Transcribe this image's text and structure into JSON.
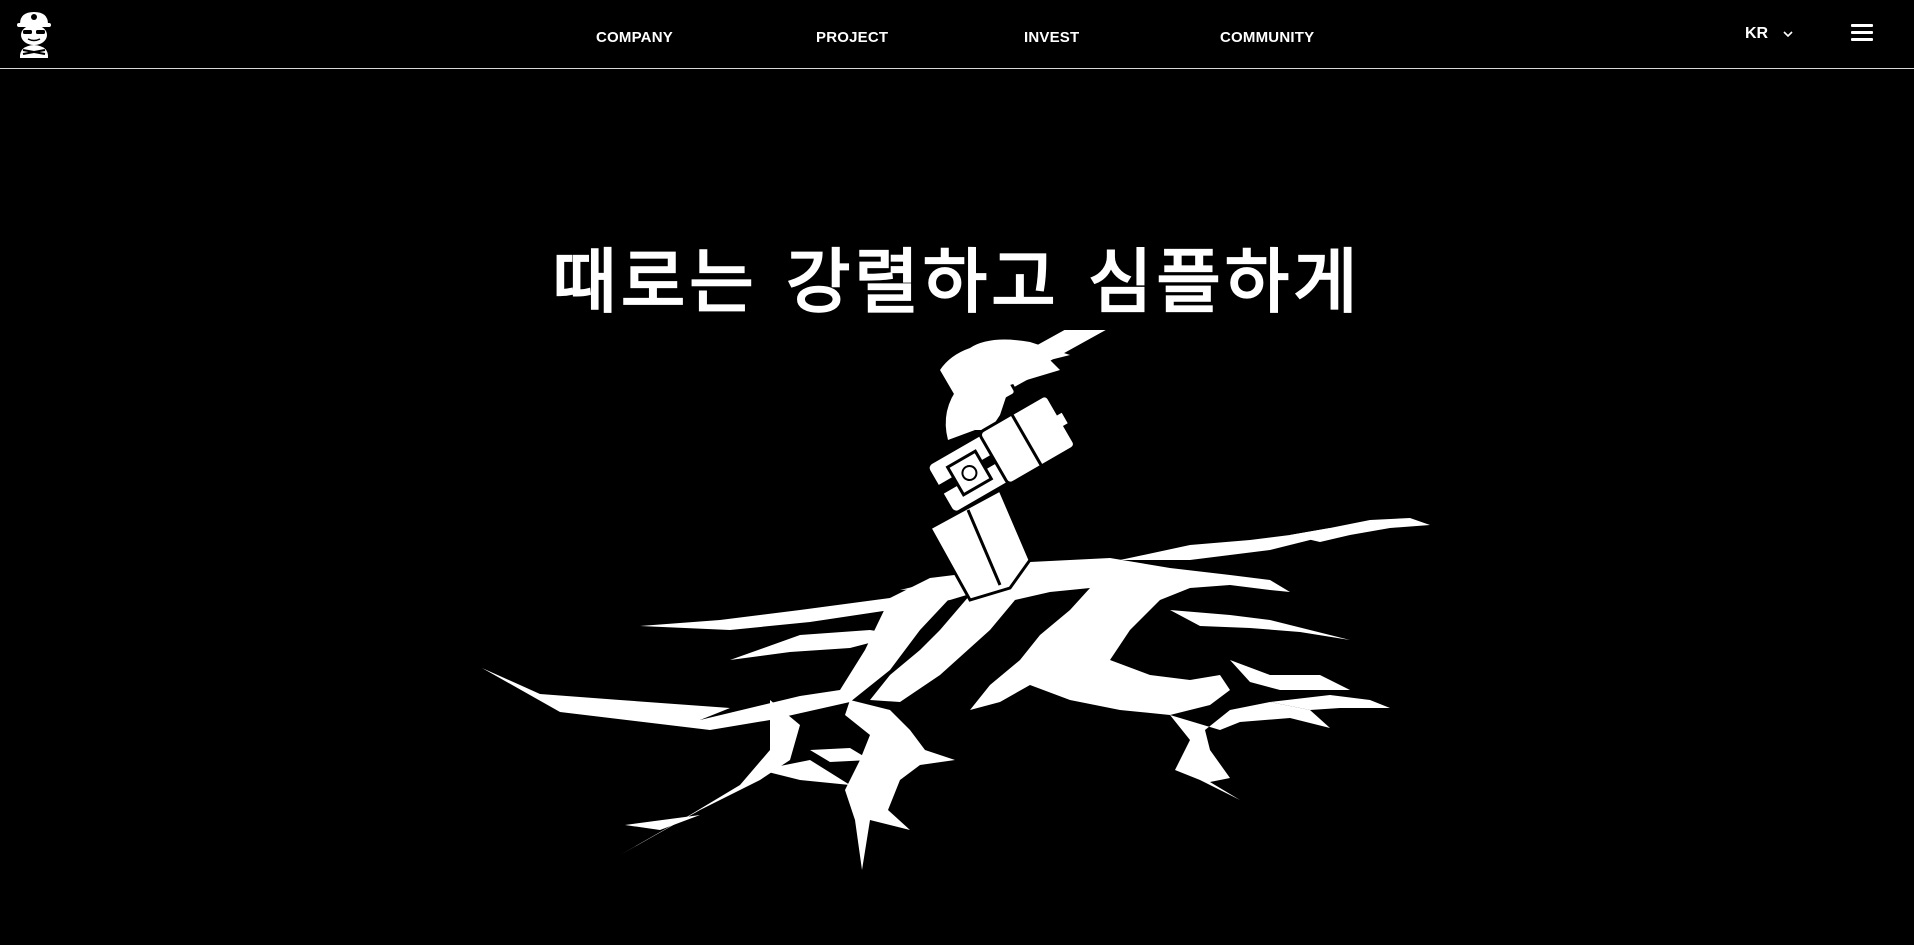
{
  "header": {
    "logo_icon": "mascot-logo-icon",
    "nav": [
      {
        "label": "COMPANY"
      },
      {
        "label": "PROJECT"
      },
      {
        "label": "INVEST"
      },
      {
        "label": "COMMUNITY"
      }
    ],
    "language": {
      "selected": "KR",
      "icon": "chevron-down-icon"
    },
    "menu_icon": "hamburger-menu-icon"
  },
  "hero": {
    "title": "때로는 강렬하고 심플하게",
    "illustration": "axe-in-cracked-ground"
  },
  "colors": {
    "background": "#000000",
    "foreground": "#ffffff",
    "divider": "#d8d8d8"
  }
}
